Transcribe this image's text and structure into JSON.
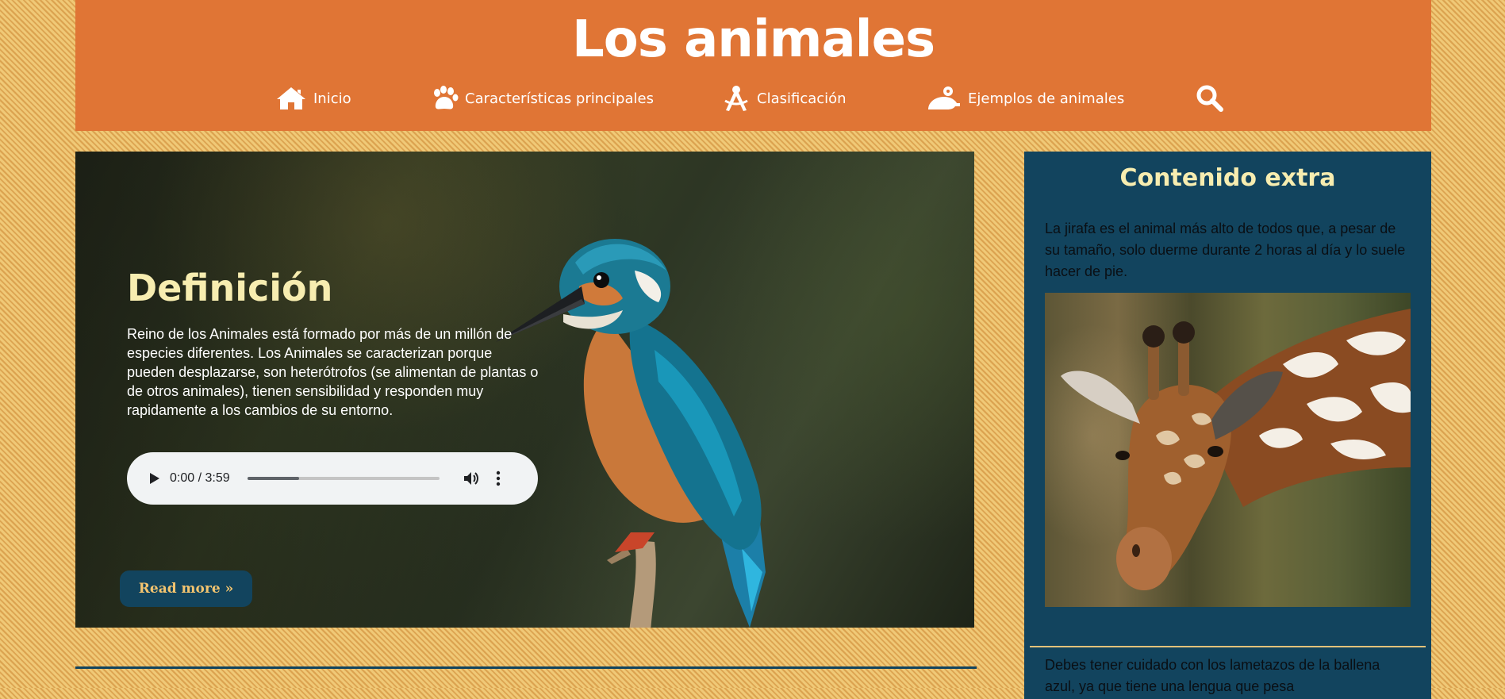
{
  "header": {
    "title": "Los animales",
    "nav": [
      {
        "label": "Inicio",
        "icon": "house-icon"
      },
      {
        "label": "Características principales",
        "icon": "paw-icon"
      },
      {
        "label": "Clasificación",
        "icon": "compass-icon"
      },
      {
        "label": "Ejemplos de animales",
        "icon": "frog-icon"
      }
    ],
    "search_icon": "magnifier-icon"
  },
  "hero": {
    "title": "Definición",
    "text": "Reino de los Animales está formado por más de un millón de especies diferentes. Los Animales se caracterizan porque pueden desplazarse, son heterótrofos (se alimentan de plantas o de otros animales), tienen sensibilidad y responden muy rapidamente a los cambios de su entorno.",
    "image": "kingfisher-photo",
    "audio": {
      "time": "0:00 / 3:59",
      "progress": 0.27
    },
    "read_more": "Read more »"
  },
  "sidebar": {
    "title": "Contenido extra",
    "fact1": "La jirafa es el animal más alto de todos que, a pesar de su tamaño, solo duerme durante 2 horas al día y lo suele hacer de pie.",
    "image": "giraffe-photo",
    "fact2": "Debes tener cuidado con los lametazos de la ballena azul, ya que tiene una lengua que pesa"
  },
  "colors": {
    "header_bg": "#e07535",
    "panel_bg": "#12445e",
    "title_accent": "#f7edb0",
    "button_text": "#f3c46f",
    "page_bg": "#e8b660"
  }
}
